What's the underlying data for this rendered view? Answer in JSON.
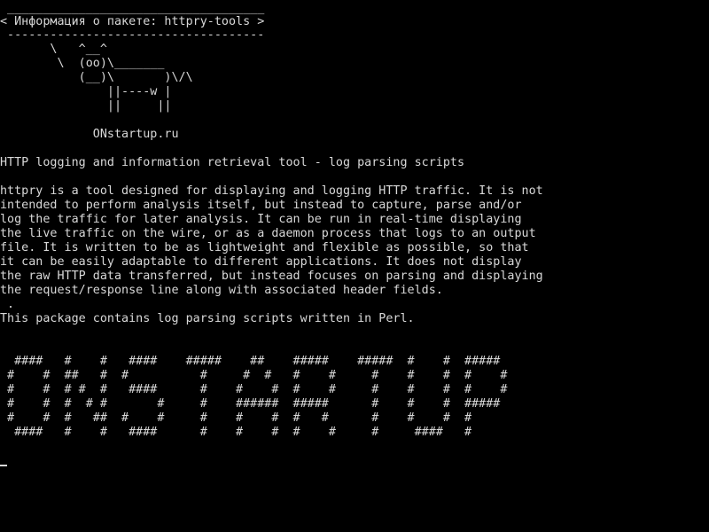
{
  "cowsay": {
    "top_border": " ____________________________________",
    "speech": "< Информация о пакете: httpry-tools >",
    "bottom_border": " ------------------------------------",
    "cow": [
      "       \\   ^__^",
      "        \\  (oo)\\_______",
      "           (__)\\       )\\/\\",
      "               ||----w |",
      "               ||     ||"
    ]
  },
  "site": "             ONstartup.ru",
  "summary": "HTTP logging and information retrieval tool - log parsing scripts",
  "description": [
    "httpry is a tool designed for displaying and logging HTTP traffic. It is not",
    "intended to perform analysis itself, but instead to capture, parse and/or",
    "log the traffic for later analysis. It can be run in real-time displaying",
    "the live traffic on the wire, or as a daemon process that logs to an output",
    "file. It is written to be as lightweight and flexible as possible, so that",
    "it can be easily adaptable to different applications. It does not display",
    "the raw HTTP data transferred, but instead focuses on parsing and displaying",
    "the request/response line along with associated header fields.",
    " .",
    "This package contains log parsing scripts written in Perl."
  ],
  "banner": [
    "  ####   #    #   ####    #####    ##    #####    #####  #    #  #####",
    " #    #  ##   #  #          #     #  #   #    #     #    #    #  #    #",
    " #    #  # #  #   ####      #    #    #  #    #     #    #    #  #    #",
    " #    #  #  # #       #     #    ######  #####      #    #    #  #####",
    " #    #  #   ##  #    #     #    #    #  #   #      #    #    #  #",
    "  ####   #    #   ####      #    #    #  #    #     #     ####   #"
  ]
}
